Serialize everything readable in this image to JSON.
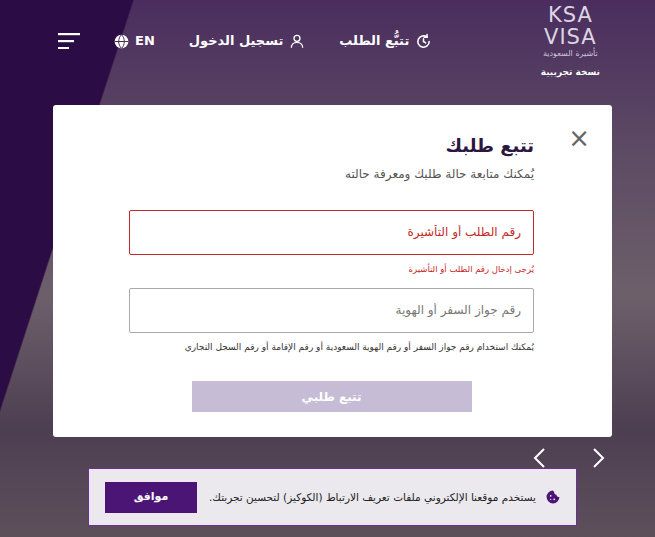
{
  "header": {
    "logo": {
      "line1": "KSA",
      "line2": "VISA",
      "tagline": "تأشيرة السعودية",
      "edition": "نسخة تجريبية"
    },
    "track_label": "تتبُّع الطلب",
    "login_label": "تسجيل الدخول",
    "language_label": "EN"
  },
  "modal": {
    "close": "×",
    "title": "تتبع طلبك",
    "subtitle": "يُمكنك متابعة حالة طلبك ومعرفة حالته",
    "fields": [
      {
        "placeholder": "رقم الطلب أو التأشيرة",
        "invalid": true,
        "feedback": "يُرجى إدخال رقم الطلب أو التأشيرة"
      },
      {
        "placeholder": "رقم جواز السفر أو الهوية",
        "invalid": false,
        "feedback": "يُمكنك استخدام رقم جواز السفر أو رقم الهوية السعودية أو رقم الإقامة أو رقم السجل التجاري"
      }
    ],
    "submit": {
      "label": "تتبع طلبي",
      "disabled": true
    }
  },
  "cookie": {
    "text": "يستخدم موقعنا الإلكتروني ملفات تعريف الارتباط (الكوكيز) لتحسين تجربتك.",
    "accept": "موافق"
  }
}
